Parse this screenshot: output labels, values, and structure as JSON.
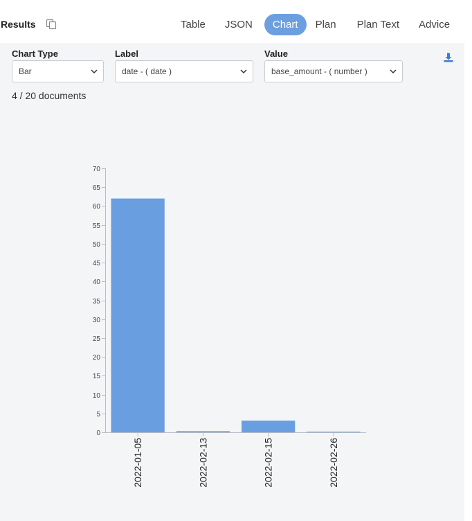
{
  "header": {
    "title": "Results",
    "copy_icon": "copy-icon"
  },
  "tabs": [
    {
      "label": "Table",
      "active": false
    },
    {
      "label": "JSON",
      "active": false
    },
    {
      "label": "Chart",
      "active": true
    },
    {
      "label": "Plan",
      "active": false
    },
    {
      "label": "Plan Text",
      "active": false
    },
    {
      "label": "Advice",
      "active": false
    }
  ],
  "controls": {
    "chart_type": {
      "label": "Chart Type",
      "value": "Bar"
    },
    "label_field": {
      "label": "Label",
      "value": "date - ( date )"
    },
    "value_field": {
      "label": "Value",
      "value": "base_amount - ( number )"
    },
    "download_icon": "download-icon"
  },
  "doc_count": "4 / 20 documents",
  "colors": {
    "accent": "#6b9fe0",
    "bar": "#699fe0",
    "panel_bg": "#f4f5f7"
  },
  "chart_data": {
    "type": "bar",
    "categories": [
      "2022-01-05",
      "2022-02-13",
      "2022-02-15",
      "2022-02-26"
    ],
    "values": [
      62,
      0.3,
      3.1,
      0.1
    ],
    "ylim": [
      0,
      70
    ],
    "yticks": [
      0,
      5,
      10,
      15,
      20,
      25,
      30,
      35,
      40,
      45,
      50,
      55,
      60,
      65,
      70
    ],
    "title": "",
    "xlabel": "",
    "ylabel": "",
    "grid": false,
    "legend": "none"
  }
}
